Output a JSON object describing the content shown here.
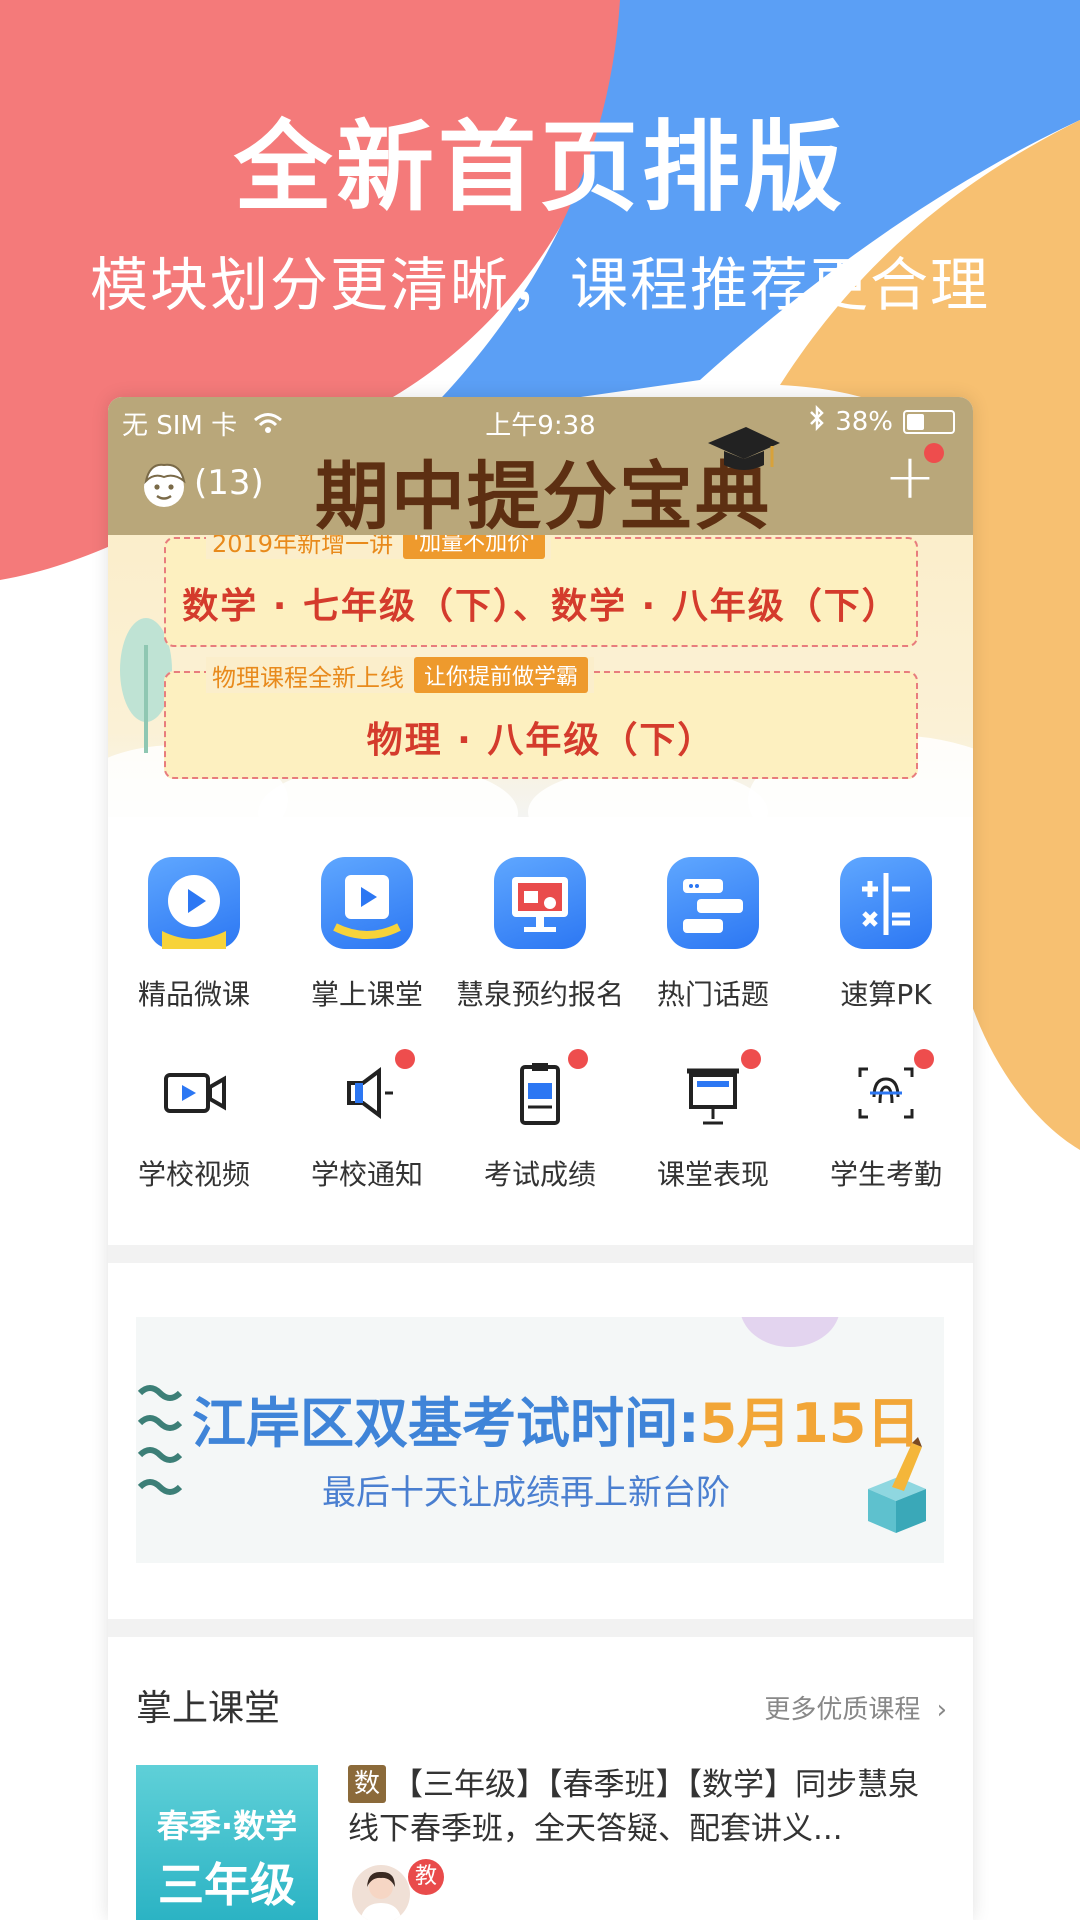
{
  "promo": {
    "title": "全新首页排版",
    "subtitle": "模块划分更清晰，课程推荐更合理"
  },
  "status_bar": {
    "carrier": "无 SIM 卡",
    "time": "上午9:38",
    "battery": "38%",
    "battery_level": 0.38
  },
  "header": {
    "message_count": "(13)",
    "banner_title": "期中提分宝典"
  },
  "banner": {
    "items": [
      {
        "tag": "2019年新增一讲",
        "badge": "'加量不加价'",
        "text": "数学 · 七年级（下）、数学 · 八年级（下）"
      },
      {
        "tag": "物理课程全新上线",
        "badge": "让你提前做学霸",
        "text": "物理 · 八年级（下）"
      }
    ]
  },
  "apps": [
    {
      "label": "精品微课",
      "icon": "play-icon",
      "badge": false
    },
    {
      "label": "掌上课堂",
      "icon": "tablet-play-icon",
      "badge": false
    },
    {
      "label": "慧泉预约报名",
      "icon": "monitor-icon",
      "badge": false
    },
    {
      "label": "热门话题",
      "icon": "chat-icon",
      "badge": false
    },
    {
      "label": "速算PK",
      "icon": "calculator-icon",
      "badge": false
    },
    {
      "label": "学校视频",
      "icon": "video-camera-icon",
      "badge": false
    },
    {
      "label": "学校通知",
      "icon": "megaphone-icon",
      "badge": true
    },
    {
      "label": "考试成绩",
      "icon": "clipboard-icon",
      "badge": true
    },
    {
      "label": "课堂表现",
      "icon": "projector-icon",
      "badge": true
    },
    {
      "label": "学生考勤",
      "icon": "fingerprint-icon",
      "badge": true
    }
  ],
  "ad": {
    "title_main": "江岸区双基考试时间:",
    "title_date": "5月15日",
    "subtitle": "最后十天让成绩再上新台阶"
  },
  "classroom": {
    "section_title": "掌上课堂",
    "more_label": "更多优质课程",
    "course": {
      "thumb_line1": "春季·数学",
      "thumb_line2": "三年级",
      "subject": "数",
      "title": "【三年级】【春季班】【数学】同步慧泉线下春季班，全天答疑、配套讲义...",
      "teacher_badge": "教"
    }
  },
  "colors": {
    "bg_red": "#f47a7a",
    "bg_blue": "#5b9ff5",
    "bg_orange": "#f7c071",
    "header_bg": "#b9a77a",
    "accent_blue": "#3f84d8",
    "accent_orange": "#f2a637"
  }
}
